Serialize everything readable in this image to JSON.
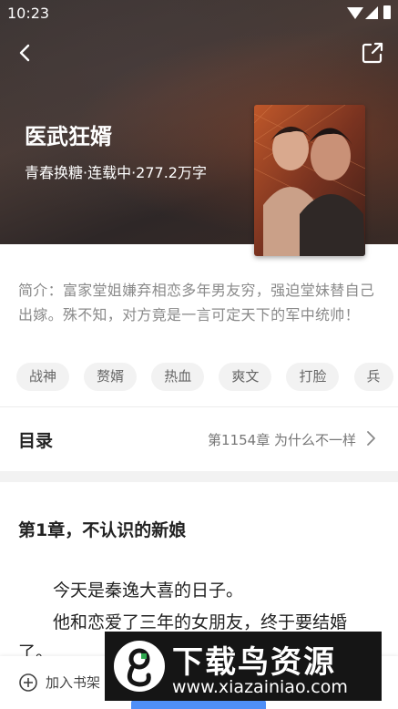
{
  "status_bar": {
    "time": "10:23"
  },
  "book": {
    "title": "医武狂婿",
    "meta": "青春换糖·连载中·277.2万字",
    "intro": "简介：富家堂姐嫌弃相恋多年男友穷，强迫堂妹替自己出嫁。殊不知，对方竟是一言可定天下的军中统帅！",
    "tags": [
      "战神",
      "赘婿",
      "热血",
      "爽文",
      "打脸",
      "兵"
    ]
  },
  "toc": {
    "label": "目录",
    "latest": "第1154章 为什么不一样"
  },
  "chapter": {
    "title": "第1章，不认识的新娘",
    "paragraphs": [
      "今天是秦逸大喜的日子。",
      "他和恋爱了三年的女朋友，终于要结婚了。"
    ]
  },
  "bottom_bar": {
    "bookshelf_label": "加入书架"
  },
  "watermark": {
    "title": "下载鸟资源",
    "url": "www.xiazainiao.com"
  }
}
